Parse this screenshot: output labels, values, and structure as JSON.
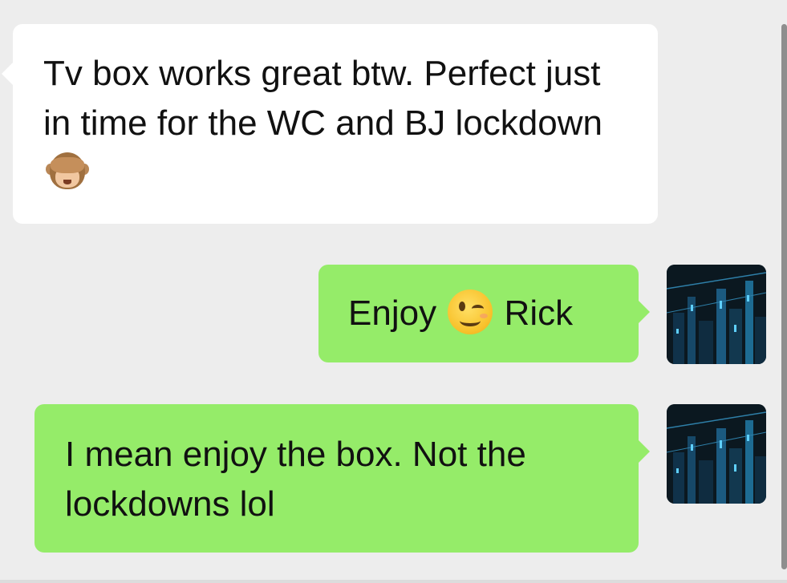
{
  "messages": [
    {
      "direction": "incoming",
      "text": "Tv box works great btw. Perfect just in time for the WC and BJ lockdown",
      "emoji": "see-no-evil-monkey",
      "bubble_color": "#ffffff"
    },
    {
      "direction": "outgoing",
      "text_before": "Enjoy",
      "emoji": "winking-face",
      "text_after": "Rick",
      "bubble_color": "#95ec69"
    },
    {
      "direction": "outgoing",
      "text": "I mean enjoy the box. Not the lockdowns lol",
      "bubble_color": "#95ec69"
    }
  ],
  "colors": {
    "background": "#ededed",
    "outgoing_bubble": "#95ec69",
    "incoming_bubble": "#ffffff"
  }
}
